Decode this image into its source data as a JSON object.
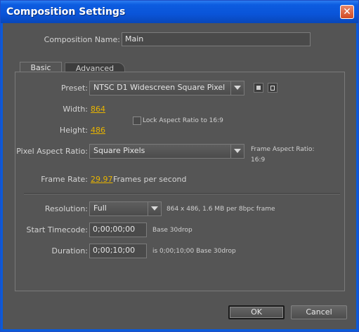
{
  "window": {
    "title": "Composition Settings"
  },
  "composition_name": {
    "label": "Composition Name:",
    "value": "Main"
  },
  "tabs": [
    {
      "label": "Basic"
    },
    {
      "label": "Advanced"
    }
  ],
  "basic": {
    "preset": {
      "label": "Preset:",
      "value": "NTSC D1 Widescreen Square Pixel"
    },
    "width": {
      "label": "Width:",
      "value": "864"
    },
    "height": {
      "label": "Height:",
      "value": "486"
    },
    "lock_aspect": {
      "label": "Lock Aspect Ratio to 16:9",
      "checked": false
    },
    "pixel_aspect_ratio": {
      "label": "Pixel Aspect Ratio:",
      "value": "Square Pixels"
    },
    "frame_aspect_ratio": {
      "label": "Frame Aspect Ratio:",
      "value": "16:9"
    },
    "frame_rate": {
      "label": "Frame Rate:",
      "value": "29.97",
      "unit": "Frames per second"
    },
    "resolution": {
      "label": "Resolution:",
      "value": "Full",
      "info": "864 x 486, 1.6 MB per 8bpc frame"
    },
    "start_timecode": {
      "label": "Start Timecode:",
      "value": "0;00;00;00",
      "info": "Base 30drop"
    },
    "duration": {
      "label": "Duration:",
      "value": "0;00;10;00",
      "info": "is 0;00;10;00  Base 30drop"
    }
  },
  "buttons": {
    "ok": "OK",
    "cancel": "Cancel"
  },
  "icons": {
    "close": "close-icon",
    "save_preset": "save-preset-icon",
    "delete_preset": "delete-preset-icon"
  },
  "colors": {
    "accent_value": "#e8b400",
    "titlebar": "#0a54d8",
    "dialog_bg": "#545454"
  }
}
